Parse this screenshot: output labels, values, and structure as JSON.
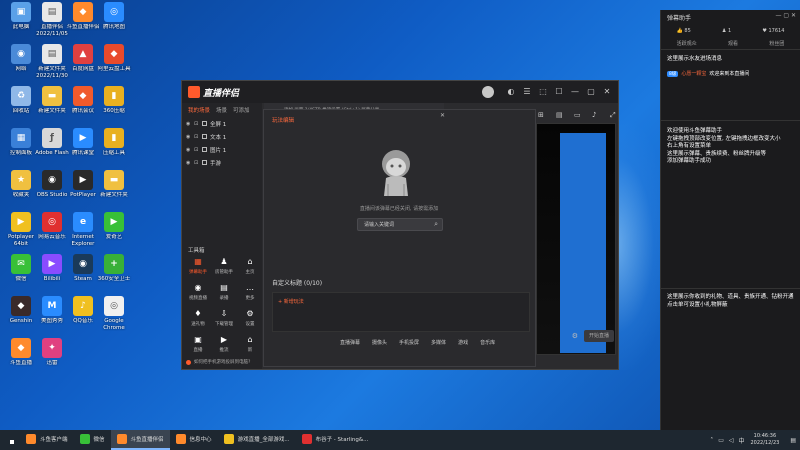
{
  "desktop": {
    "icons": [
      {
        "label": "此电脑",
        "color": "#5aa0e8",
        "glyph": "▣"
      },
      {
        "label": "直播伴侣 2022/11/05",
        "color": "#e8e8e8",
        "glyph": "▤"
      },
      {
        "label": "斗鱼直播伴侣",
        "color": "#ff8a2c",
        "glyph": "◆"
      },
      {
        "label": "腾讯地图",
        "color": "#2a8cff",
        "glyph": "◎"
      },
      {
        "label": "网络",
        "color": "#4a8ad8",
        "glyph": "◉"
      },
      {
        "label": "新建文件夹 2022/11/30",
        "color": "#e8e8e8",
        "glyph": "▤"
      },
      {
        "label": "百度网盘",
        "color": "#e04040",
        "glyph": "▲"
      },
      {
        "label": "阿里云盘工具",
        "color": "#e84a2c",
        "glyph": "◆"
      },
      {
        "label": "回收站",
        "color": "#8fb8e8",
        "glyph": "♻"
      },
      {
        "label": "新建文件夹",
        "color": "#f0c040",
        "glyph": "▬"
      },
      {
        "label": "腾讯会议",
        "color": "#f05a2c",
        "glyph": "◆"
      },
      {
        "label": "360压缩",
        "color": "#e8b020",
        "glyph": "▮"
      },
      {
        "label": "控制面板",
        "color": "#3a80d8",
        "glyph": "▦"
      },
      {
        "label": "Adobe Flash",
        "color": "#d8d8d8",
        "glyph": "ƒ"
      },
      {
        "label": "腾讯课堂",
        "color": "#2a8cff",
        "glyph": "▶"
      },
      {
        "label": "压缩工具",
        "color": "#e8b020",
        "glyph": "▮"
      },
      {
        "label": "收藏夹",
        "color": "#f0c040",
        "glyph": "★"
      },
      {
        "label": "OBS Studio",
        "color": "#2a2a2a",
        "glyph": "◉"
      },
      {
        "label": "PotPlayer",
        "color": "#2a2a2a",
        "glyph": "▶"
      },
      {
        "label": "新建文件夹",
        "color": "#f0c040",
        "glyph": "▬"
      },
      {
        "label": "Potplayer 64bit",
        "color": "#f0c020",
        "glyph": "▶"
      },
      {
        "label": "网易云音乐",
        "color": "#e03030",
        "glyph": "◎"
      },
      {
        "label": "Internet Explorer",
        "color": "#2a8cff",
        "glyph": "e"
      },
      {
        "label": "爱奇艺",
        "color": "#38c038",
        "glyph": "▶"
      },
      {
        "label": "微信",
        "color": "#38c038",
        "glyph": "✉"
      },
      {
        "label": "Bilibili",
        "color": "#8a4cff",
        "glyph": "▶"
      },
      {
        "label": "Steam",
        "color": "#1a3a5a",
        "glyph": "◉"
      },
      {
        "label": "360安全卫士",
        "color": "#38b038",
        "glyph": "+"
      },
      {
        "label": "Genshin",
        "color": "#3a2a2a",
        "glyph": "◆"
      },
      {
        "label": "美图秀秀",
        "color": "#2a8cff",
        "glyph": "M"
      },
      {
        "label": "QQ音乐",
        "color": "#f0c020",
        "glyph": "♪"
      },
      {
        "label": "Google Chrome",
        "color": "#f0f0f0",
        "glyph": "◎"
      },
      {
        "label": "斗鱼直播",
        "color": "#ff8a2c",
        "glyph": "◆"
      },
      {
        "label": "迅雷",
        "color": "#e04080",
        "glyph": "✦"
      }
    ]
  },
  "app": {
    "name": "直播伴侣",
    "left_tabs": [
      "我的场景",
      "场景",
      "可添加"
    ],
    "sources": [
      {
        "label": "全屏 1"
      },
      {
        "label": "文本 1"
      },
      {
        "label": "图片 1"
      },
      {
        "label": "手游"
      }
    ],
    "tools_title": "工具箱",
    "tools": [
      {
        "label": "弹幕助手",
        "glyph": "▦",
        "hot": true
      },
      {
        "label": "房管助手",
        "glyph": "♟",
        "hot": false
      },
      {
        "label": "主页",
        "glyph": "⌂",
        "hot": false
      },
      {
        "label": "视频直播",
        "glyph": "◉",
        "hot": false
      },
      {
        "label": "录播",
        "glyph": "▤",
        "hot": false
      },
      {
        "label": "更多",
        "glyph": "…",
        "hot": false
      },
      {
        "label": "送礼物",
        "glyph": "♦",
        "hot": false
      },
      {
        "label": "下载管理",
        "glyph": "⇩",
        "hot": false
      },
      {
        "label": "设置",
        "glyph": "⚙",
        "hot": false
      },
      {
        "label": "直播",
        "glyph": "▣",
        "hot": false
      },
      {
        "label": "推流",
        "glyph": "▶",
        "hot": false
      },
      {
        "label": "新",
        "glyph": "⌂",
        "hot": false
      }
    ],
    "bottom_hint": "如何把手机游戏投屏到电脑?",
    "center_top_text": "添加 画面 1/4STR 推流设置 (Ctrl+1) 屏幕分享 ...",
    "go_live_label": "开始直播",
    "title_buttons": [
      "◐",
      "☰",
      "⬚",
      "☐",
      "—",
      "▢",
      "✕"
    ]
  },
  "dialog": {
    "title": "玩法编辑",
    "close": "✕",
    "empty_text": "直播间该弹幕已经关闭, 请按需添加",
    "search_placeholder": "请输入关键词",
    "custom_title": "自定义标题 (0/10)",
    "add_label": "+ 新增玩法",
    "bottom_items": [
      "直播弹幕",
      "摄像头",
      "手机投屏",
      "多媒体",
      "游戏",
      "音乐库"
    ]
  },
  "side_panel": {
    "title": "弹幕助手",
    "window_buttons": "— ▢ ✕",
    "stats": [
      "👍 85",
      "♟ 1",
      "♥ 17614"
    ],
    "tabs": [
      "活跃观众",
      "观看",
      "粉丝团"
    ],
    "line1": "这里展示水友进场消息",
    "welcome_badge": "8级",
    "welcome_user": "心愿一颗宝",
    "welcome_msg": "欢迎来到本直播间",
    "line2": "欢迎使用斗鱼弹幕助手\n左键拖拽顶部改变位置, 左键拖拽边框改变大小\n右上角有设置菜单\n这里展示弹幕、贵族续费、粉丝牌升级等\n添加弹幕助手成功",
    "line3": "这里展示你收到的礼物、道具、贵族开通、钻粉开通\n点击单可设置小礼物屏蔽"
  },
  "taskbar": {
    "items": [
      {
        "label": "斗鱼客户端",
        "color": "#ff8a2c",
        "active": false
      },
      {
        "label": "微信",
        "color": "#38c038",
        "active": false
      },
      {
        "label": "斗鱼直播伴侣",
        "color": "#ff8a2c",
        "active": true
      },
      {
        "label": "信息中心",
        "color": "#ff8a2c",
        "active": false
      },
      {
        "label": "游戏直播_全部游戏...",
        "color": "#f0c020",
        "active": false
      },
      {
        "label": "布谷子 - Starling&...",
        "color": "#e03030",
        "active": false
      }
    ],
    "time": "10:46:36",
    "date": "2022/12/23"
  }
}
